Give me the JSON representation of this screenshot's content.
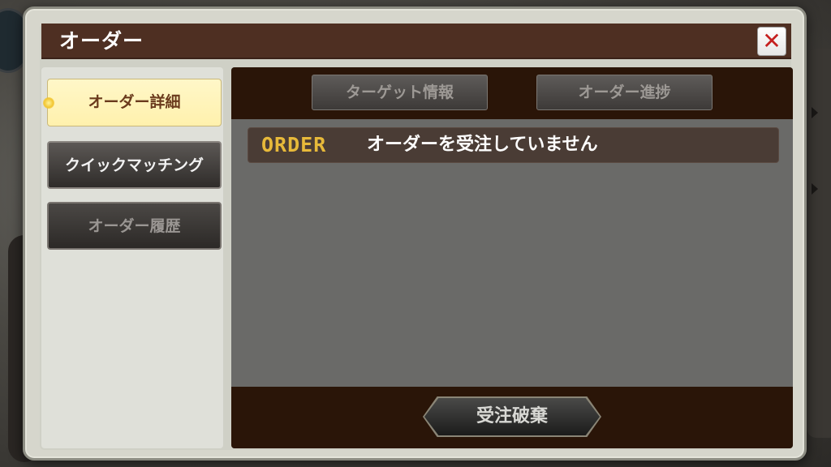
{
  "dialog": {
    "title": "オーダー",
    "close_label": "✕"
  },
  "sidebar": {
    "items": [
      {
        "label": "オーダー詳細",
        "state": "active"
      },
      {
        "label": "クイックマッチング",
        "state": "normal"
      },
      {
        "label": "オーダー履歴",
        "state": "disabled"
      }
    ]
  },
  "tabs": [
    {
      "label": "ターゲット情報"
    },
    {
      "label": "オーダー進捗"
    }
  ],
  "order": {
    "logo": "ORDER",
    "status": "オーダーを受注していません"
  },
  "footer": {
    "discard_label": "受注破棄"
  },
  "colors": {
    "title_bar": "#4e2f22",
    "active_item": "#fff1ad",
    "order_logo": "#e7b93a",
    "close_x": "#c51f1f"
  }
}
